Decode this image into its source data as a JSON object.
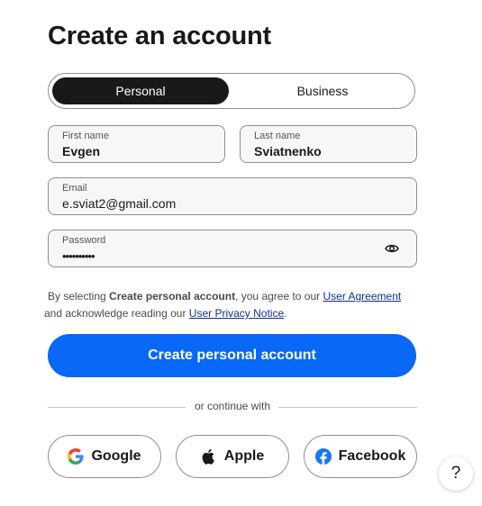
{
  "page": {
    "title": "Create an account"
  },
  "account_type": {
    "options": [
      "Personal",
      "Business"
    ],
    "selected": "Personal"
  },
  "form": {
    "first_name": {
      "label": "First name",
      "value": "Evgen"
    },
    "last_name": {
      "label": "Last name",
      "value": "Sviatnenko"
    },
    "email": {
      "label": "Email",
      "value": "e.sviat2@gmail.com"
    },
    "password": {
      "label": "Password",
      "value": "••••••••••"
    }
  },
  "legal": {
    "part1": "By selecting ",
    "bold": "Create personal account",
    "part2": ", you agree to our ",
    "link1": "User Agreement",
    "part3": " and acknowledge reading our ",
    "link2": "User Privacy Notice",
    "part4": "."
  },
  "submit_label": "Create personal account",
  "divider_text": "or continue with",
  "social": {
    "google": "Google",
    "apple": "Apple",
    "facebook": "Facebook"
  },
  "help_label": "?",
  "colors": {
    "primary": "#0968f6",
    "dark": "#191919",
    "link": "#0d2f8f",
    "facebook": "#1877f2"
  }
}
